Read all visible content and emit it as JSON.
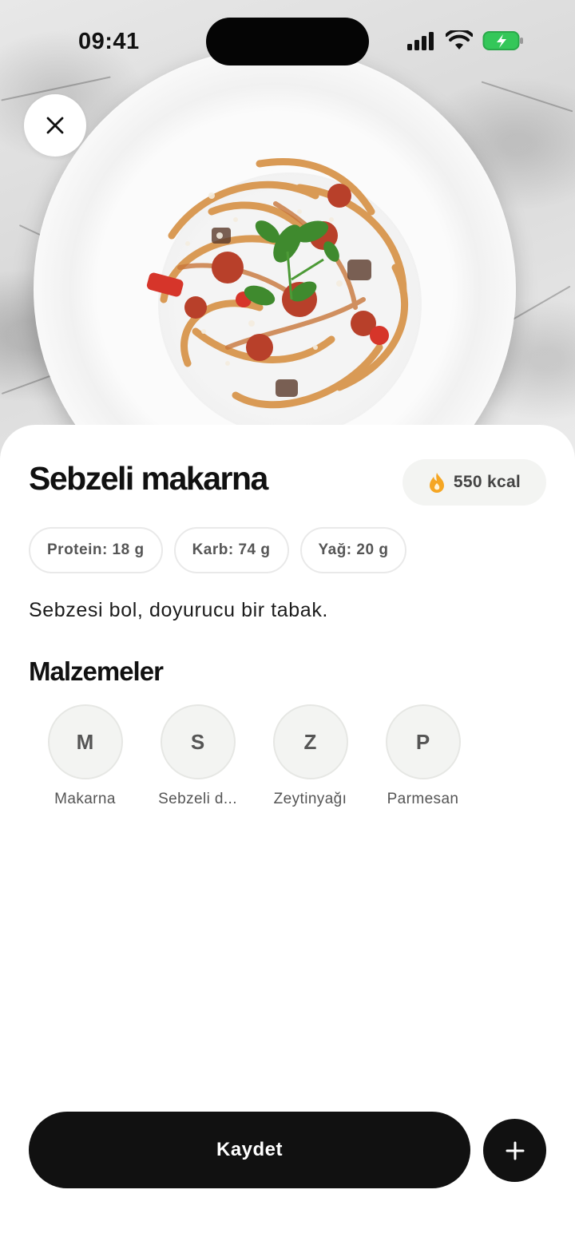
{
  "status_bar": {
    "time": "09:41",
    "icons": [
      "signal-icon",
      "wifi-icon",
      "battery-charging-icon"
    ]
  },
  "hero": {
    "image_alt_icon": "pasta-dish-photo",
    "close_icon": "close-icon"
  },
  "dish": {
    "title": "Sebzeli makarna",
    "calories": "550 kcal",
    "calorie_icon": "flame-icon",
    "macros": [
      {
        "label": "Protein: 18 g"
      },
      {
        "label": "Karb: 74 g"
      },
      {
        "label": "Yağ: 20 g"
      }
    ],
    "description": "Sebzesi bol, doyurucu bir tabak."
  },
  "ingredients": {
    "title": "Malzemeler",
    "items": [
      {
        "initial": "M",
        "name": "Makarna"
      },
      {
        "initial": "S",
        "name": "Sebzeli d..."
      },
      {
        "initial": "Z",
        "name": "Zeytinyağı"
      },
      {
        "initial": "P",
        "name": "Parmesan"
      }
    ]
  },
  "actions": {
    "save_label": "Kaydet",
    "add_icon": "plus-icon"
  },
  "colors": {
    "primary": "#111111",
    "chip_bg": "#f3f4f2",
    "flame": "#f5a623",
    "battery": "#34c759"
  }
}
